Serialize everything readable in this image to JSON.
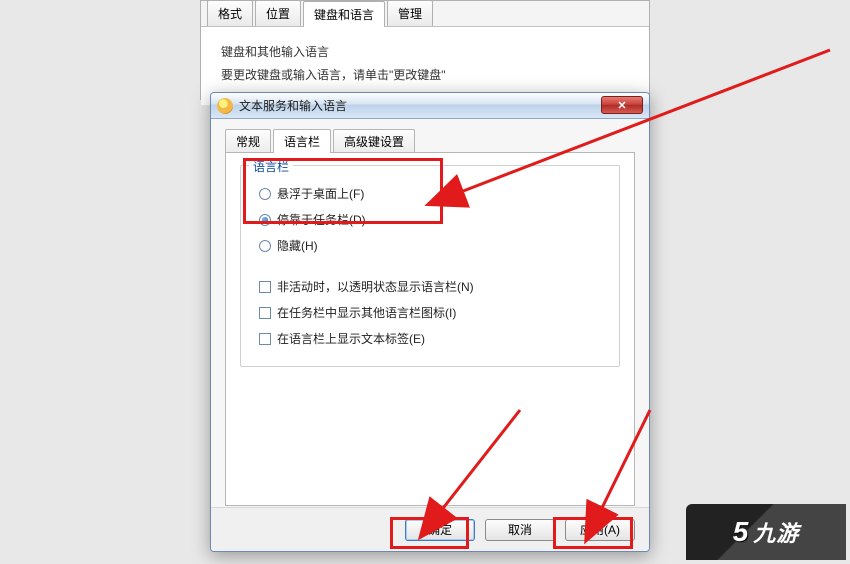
{
  "parent": {
    "tabs": [
      "格式",
      "位置",
      "键盘和语言",
      "管理"
    ],
    "active_tab_index": 2,
    "section_title": "键盘和其他输入语言",
    "section_sub": "要更改键盘或输入语言，请单击\"更改键盘\""
  },
  "dialog": {
    "title": "文本服务和输入语言",
    "close_glyph": "✕",
    "tabs": [
      "常规",
      "语言栏",
      "高级键设置"
    ],
    "active_tab_index": 1,
    "group_legend": "语言栏",
    "radios": [
      {
        "label": "悬浮于桌面上(F)",
        "selected": false
      },
      {
        "label": "停靠于任务栏(D)",
        "selected": true
      },
      {
        "label": "隐藏(H)",
        "selected": false
      }
    ],
    "checks": [
      {
        "label": "非活动时，以透明状态显示语言栏(N)",
        "checked": false
      },
      {
        "label": "在任务栏中显示其他语言栏图标(I)",
        "checked": false
      },
      {
        "label": "在语言栏上显示文本标签(E)",
        "checked": false
      }
    ],
    "buttons": {
      "ok": "确定",
      "cancel": "取消",
      "apply": "应用(A)"
    }
  },
  "corner_logo": "九游"
}
